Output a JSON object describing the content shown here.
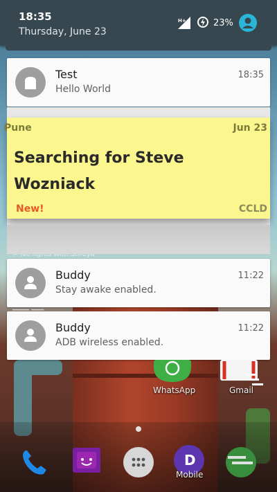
{
  "status_bar": {
    "time": "18:35",
    "date": "Thursday, June 23",
    "network": "H+",
    "battery": "23%"
  },
  "notifications": [
    {
      "title": "Test",
      "text": "Hello World",
      "time": "18:35",
      "icon": "android-icon"
    },
    {
      "title": "Buddy",
      "text": "Stay awake enabled.",
      "time": "11:22",
      "icon": "person-icon"
    },
    {
      "title": "Buddy",
      "text": "ADB wireless enabled.",
      "time": "11:22",
      "icon": "person-icon"
    }
  ],
  "sticky_note": {
    "header_left": "Pune",
    "header_right": "Jun 23",
    "body": "Searching for Steve Wozniack",
    "new_label": "New!",
    "tag": "CCLD",
    "color": "#fbf68d"
  },
  "home": {
    "apps": [
      {
        "label": "WhatsApp"
      },
      {
        "label": "Gmail"
      }
    ],
    "dock": [
      {
        "icon": "phone-icon"
      },
      {
        "icon": "messaging-icon"
      },
      {
        "icon": "app-drawer-icon"
      },
      {
        "icon": "mobile-icon",
        "label": "Mobile"
      },
      {
        "icon": "browser-icon"
      }
    ]
  },
  "colors": {
    "status_bar": "#37474f",
    "accent": "#29b6d8"
  }
}
